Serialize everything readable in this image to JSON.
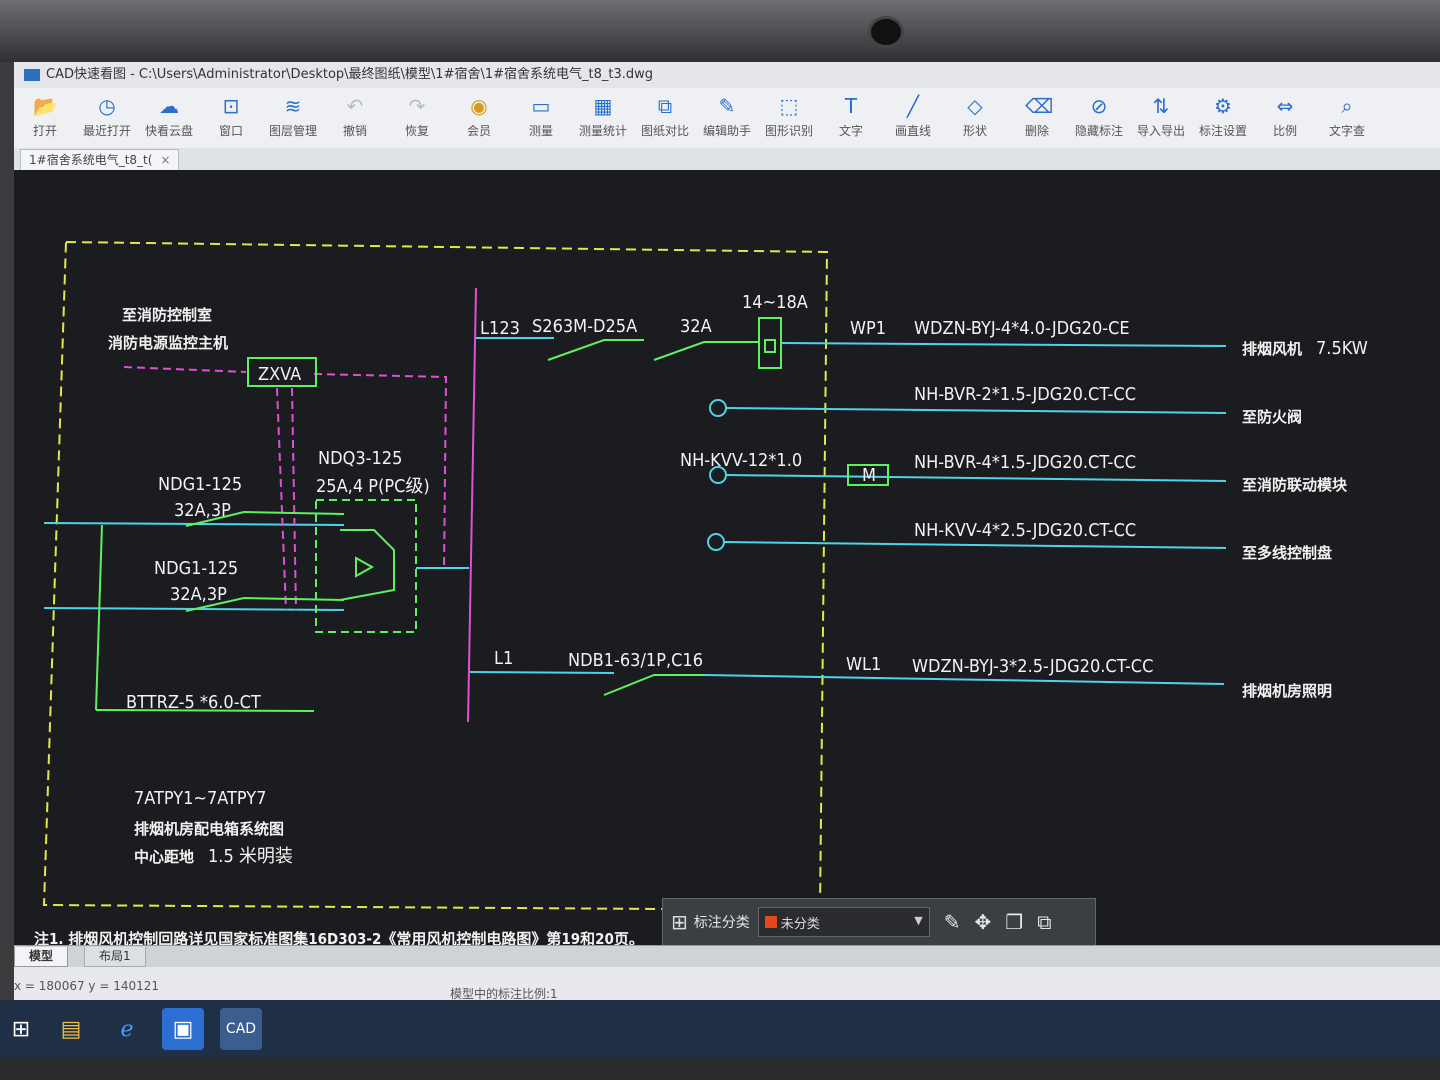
{
  "window": {
    "title": "CAD快速看图 - C:\\Users\\Administrator\\Desktop\\最终图纸\\模型\\1#宿舍\\1#宿舍系统电气_t8_t3.dwg"
  },
  "toolbar": [
    {
      "label": "打开",
      "icon": "folder-open-icon"
    },
    {
      "label": "最近打开",
      "icon": "clock-icon"
    },
    {
      "label": "快看云盘",
      "icon": "cloud-icon"
    },
    {
      "label": "窗口",
      "icon": "window-icon"
    },
    {
      "label": "图层管理",
      "icon": "layers-icon"
    },
    {
      "label": "撤销",
      "icon": "undo-icon"
    },
    {
      "label": "恢复",
      "icon": "redo-icon"
    },
    {
      "label": "会员",
      "icon": "vip-icon"
    },
    {
      "label": "测量",
      "icon": "ruler-icon"
    },
    {
      "label": "测量统计",
      "icon": "measure-stats-icon"
    },
    {
      "label": "图纸对比",
      "icon": "compare-icon"
    },
    {
      "label": "编辑助手",
      "icon": "edit-assistant-icon"
    },
    {
      "label": "图形识别",
      "icon": "shape-recognize-icon"
    },
    {
      "label": "文字",
      "icon": "text-icon"
    },
    {
      "label": "画直线",
      "icon": "line-icon"
    },
    {
      "label": "形状",
      "icon": "shape-icon"
    },
    {
      "label": "删除",
      "icon": "eraser-icon"
    },
    {
      "label": "隐藏标注",
      "icon": "hide-annotation-icon"
    },
    {
      "label": "导入导出",
      "icon": "import-export-icon"
    },
    {
      "label": "标注设置",
      "icon": "annotation-settings-icon"
    },
    {
      "label": "比例",
      "icon": "scale-icon"
    },
    {
      "label": "文字查",
      "icon": "text-search-icon"
    }
  ],
  "doc_tab": {
    "label": "1#宿舍系统电气_t8_t(",
    "close": "×"
  },
  "drawing": {
    "left_labels": {
      "fire_control_room": "至消防控制室",
      "fire_power_monitor": "消防电源监控主机",
      "zxva": "ZXVA",
      "ndg1_a": "NDG1-125",
      "ndg1_a_rating": "32A,3P",
      "ndg1_b": "NDG1-125",
      "ndg1_b_rating": "32A,3P",
      "ndq3": "NDQ3-125",
      "ndq3_rating": "25A,4 P(PC级)",
      "bttrz": "BTTRZ-5 *6.0-CT",
      "panel_id": "7ATPY1~7ATPY7",
      "panel_desc": "排烟机房配电箱系统图",
      "center_height_label": "中心距地",
      "center_height_value": "1.5 米明装"
    },
    "circuits": [
      {
        "bus": "L123",
        "breaker": "S263M-D25A",
        "contactor": "32A",
        "relay": "14~18A",
        "id": "WP1",
        "cable": "WDZN-BYJ-4*4.0-JDG20-CE",
        "dest": "排烟风机",
        "power": "7.5KW"
      },
      {
        "cable": "NH-BVR-2*1.5-JDG20.CT-CC",
        "dest": "至防火阀"
      },
      {
        "control": "NH-KVV-12*1.0",
        "module": "M",
        "cable": "NH-BVR-4*1.5-JDG20.CT-CC",
        "dest": "至消防联动模块"
      },
      {
        "cable": "NH-KVV-4*2.5-JDG20.CT-CC",
        "dest": "至多线控制盘"
      },
      {
        "bus": "L1",
        "breaker": "NDB1-63/1P,C16",
        "id": "WL1",
        "cable": "WDZN-BYJ-3*2.5-JDG20.CT-CC",
        "dest": "排烟机房照明"
      }
    ],
    "note": "注1. 排烟风机控制回路详见国家标准图集16D303-2《常用风机控制电路图》第19和20页。"
  },
  "annotation_bar": {
    "label": "标注分类",
    "category": "未分类"
  },
  "layout_tabs": {
    "model": "模型",
    "layout1": "布局1"
  },
  "status": {
    "coords": "x = 180067  y = 140121",
    "scale": "模型中的标注比例:1"
  },
  "colors": {
    "cyan": "#4fd3e6",
    "green": "#5ef05e",
    "magenta": "#e04fd6",
    "yellow": "#e6e64a",
    "canvas": "#1b1c1f"
  }
}
